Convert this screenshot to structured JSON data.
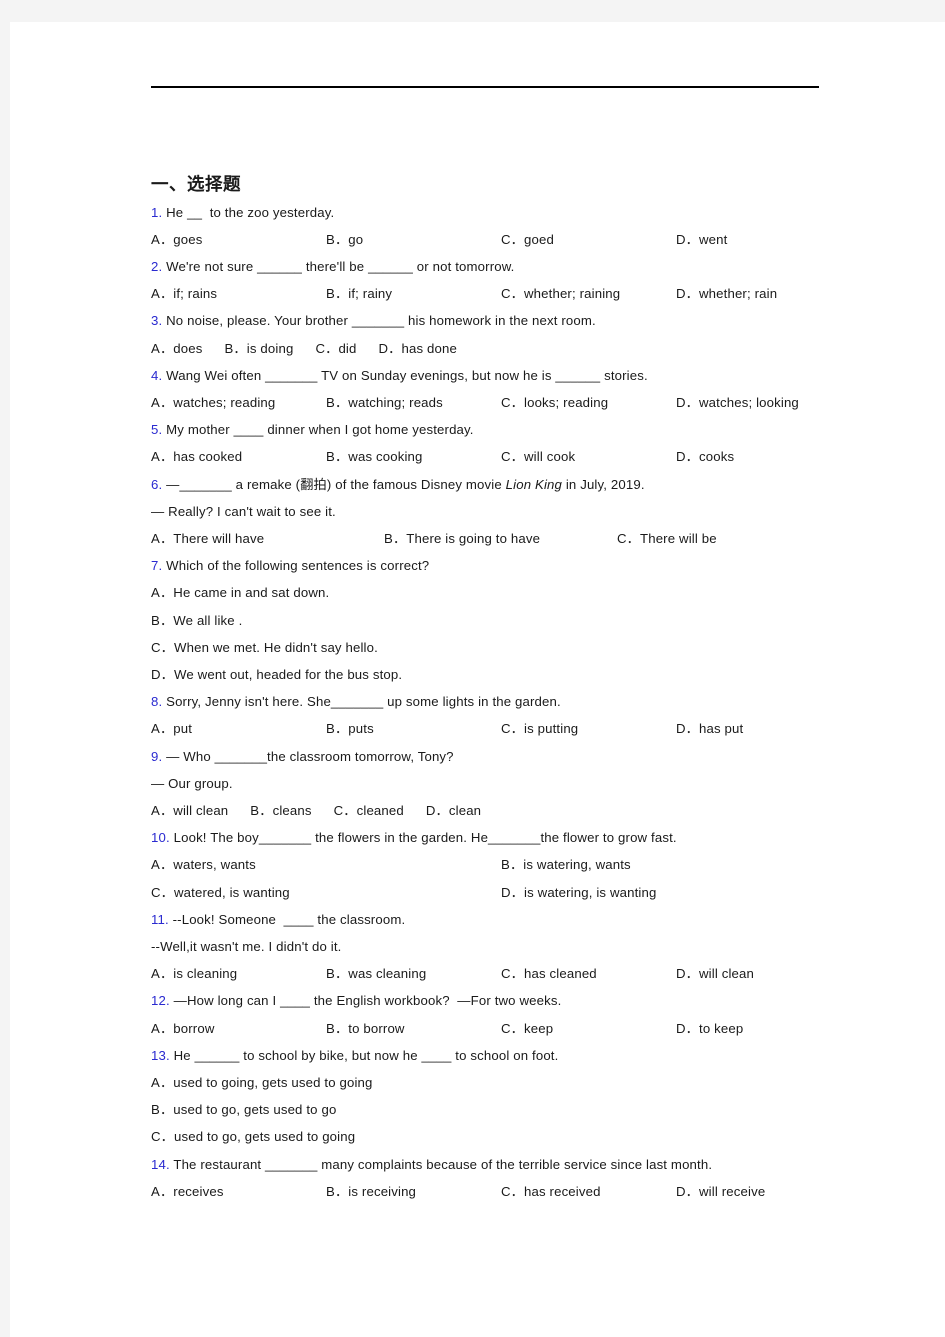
{
  "document": {
    "section_title": "一、选择题",
    "questions": [
      {
        "num": "1.",
        "stem": " He __  to the zoo yesterday.",
        "options": [
          "A．goes",
          "B．go",
          "C．goed",
          "D．went"
        ],
        "layout": "c4"
      },
      {
        "num": "2.",
        "stem": " We're not sure ______ there'll be ______ or not tomorrow.",
        "options": [
          "A．if; rains",
          "B．if; rainy",
          "C．whether; raining",
          "D．whether; rain"
        ],
        "layout": "c4"
      },
      {
        "num": "3.",
        "stem": " No noise, please. Your brother _______ his homework in the next room.",
        "options": [
          "A．does",
          "B．is doing",
          "C．did",
          "D．has done"
        ],
        "layout": "cflow"
      },
      {
        "num": "4.",
        "stem": " Wang Wei often _______ TV on Sunday evenings, but now he is ______ stories.",
        "options": [
          "A．watches; reading",
          "B．watching; reads",
          "C．looks; reading",
          "D．watches; looking"
        ],
        "layout": "c4"
      },
      {
        "num": "5.",
        "stem": " My mother ____ dinner when I got home yesterday.",
        "options": [
          "A．has cooked",
          "B．was cooking",
          "C．will cook",
          "D．cooks"
        ],
        "layout": "c4"
      },
      {
        "num": "6.",
        "stem_pre": " —_______ a remake (翻拍) of the famous Disney movie ",
        "stem_italic": "Lion King",
        "stem_post": " in July, 2019.",
        "stem_line2": "— Really? I can't wait to see it.",
        "options": [
          "A．There will have",
          "B．There is going to have",
          "C．There will be"
        ],
        "layout": "c3"
      },
      {
        "num": "7.",
        "stem": " Which of the following sentences is correct?",
        "options": [
          "A．He came in and sat down.",
          "B．We all like .",
          "C．When we met. He didn't say hello.",
          "D．We went out, headed for the bus stop."
        ],
        "layout": "stack"
      },
      {
        "num": "8.",
        "stem": " Sorry, Jenny isn't here. She_______ up some lights in the garden.",
        "options": [
          "A．put",
          "B．puts",
          "C．is putting",
          "D．has put"
        ],
        "layout": "c4"
      },
      {
        "num": "9.",
        "stem": " — Who _______the classroom tomorrow, Tony?",
        "stem_line2": "— Our group.",
        "options": [
          "A．will clean",
          "B．cleans",
          "C．cleaned",
          "D．clean"
        ],
        "layout": "cflow"
      },
      {
        "num": "10.",
        "stem": " Look! The boy_______ the flowers in the garden. He_______the flower to grow fast.",
        "options": [
          "A．waters, wants",
          "B．is watering, wants",
          "C．watered, is wanting",
          "D．is watering, is wanting"
        ],
        "layout": "c2"
      },
      {
        "num": "11.",
        "stem": " --Look! Someone  ____ the classroom.",
        "stem_line2": "--Well,it wasn't me. I didn't do it.",
        "options": [
          "A．is cleaning",
          "B．was cleaning",
          "C．has cleaned",
          "D．will clean"
        ],
        "layout": "c4"
      },
      {
        "num": "12.",
        "stem": " —How long can I ____ the English workbook?  —For two weeks.",
        "options": [
          "A．borrow",
          "B．to borrow",
          "C．keep",
          "D．to keep"
        ],
        "layout": "c4"
      },
      {
        "num": "13.",
        "stem": " He ______ to school by bike, but now he ____ to school on foot.",
        "options": [
          "A．used to going, gets used to going",
          "B．used to go, gets used to go",
          "C．used to go, gets used to going"
        ],
        "layout": "stack"
      },
      {
        "num": "14.",
        "stem": " The restaurant _______ many complaints because of the terrible service since last month.",
        "options": [
          "A．receives",
          "B．is receiving",
          "C．has received",
          "D．will receive"
        ],
        "layout": "c4"
      }
    ]
  },
  "colors": {
    "question_number": "#2a2ad0",
    "body_text": "#1a1a1a",
    "page_background": "#ffffff",
    "canvas_background": "#f4f4f4"
  }
}
